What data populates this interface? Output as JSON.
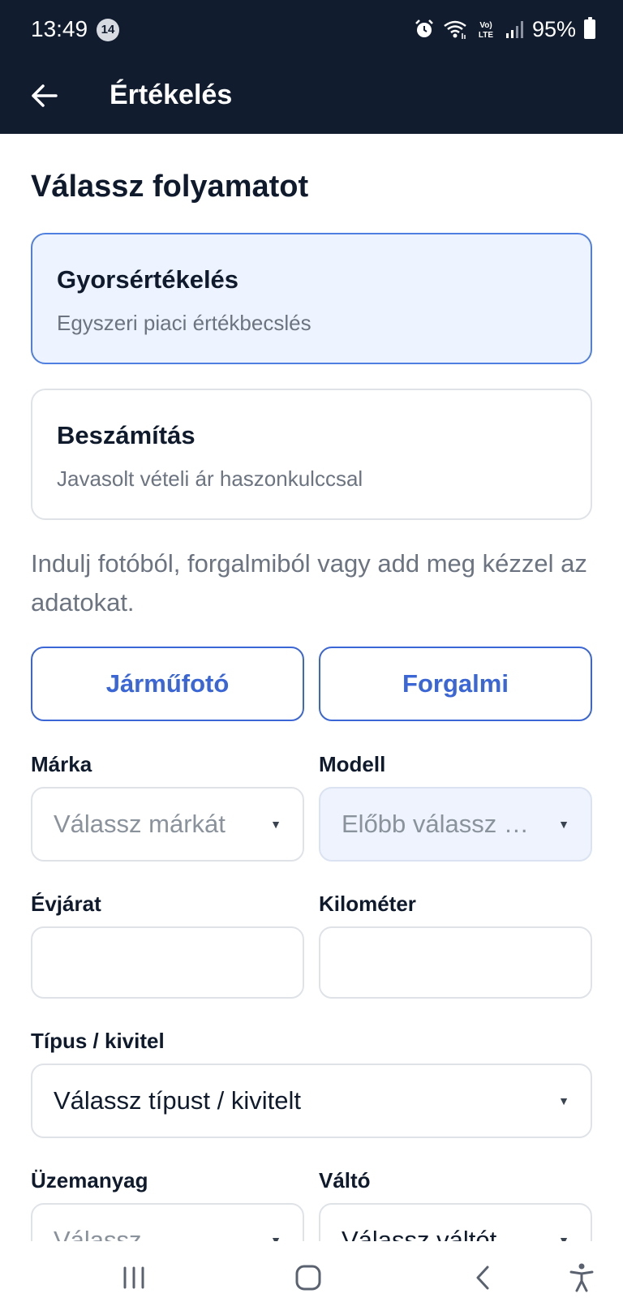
{
  "status_bar": {
    "time": "13:49",
    "notification_count": "14",
    "battery": "95%",
    "volte_label": "Vo) LTE"
  },
  "app_bar": {
    "title": "Értékelés"
  },
  "process": {
    "heading": "Válassz folyamatot",
    "options": [
      {
        "title": "Gyorsértékelés",
        "subtitle": "Egyszeri piaci értékbecslés",
        "selected": true
      },
      {
        "title": "Beszámítás",
        "subtitle": "Javasolt vételi ár haszonkulccsal",
        "selected": false
      }
    ]
  },
  "hint": "Indulj fotóból, forgalmiból vagy add meg kézzel az adatokat.",
  "buttons": {
    "photo": "Járműfotó",
    "registration": "Forgalmi"
  },
  "form": {
    "make": {
      "label": "Márka",
      "placeholder": "Válassz márkát"
    },
    "model": {
      "label": "Modell",
      "placeholder": "Előbb válassz …"
    },
    "year": {
      "label": "Évjárat",
      "value": ""
    },
    "mileage": {
      "label": "Kilométer",
      "value": ""
    },
    "body_type": {
      "label": "Típus / kivitel",
      "placeholder": "Válassz típust / kivitelt"
    },
    "fuel": {
      "label": "Üzemanyag",
      "placeholder": "Válassz …"
    },
    "transmission": {
      "label": "Váltó",
      "placeholder": "Válassz váltót"
    }
  },
  "colors": {
    "header_bg": "#111c2e",
    "accent": "#3a66d6",
    "selected_card_bg": "#eef4ff"
  }
}
